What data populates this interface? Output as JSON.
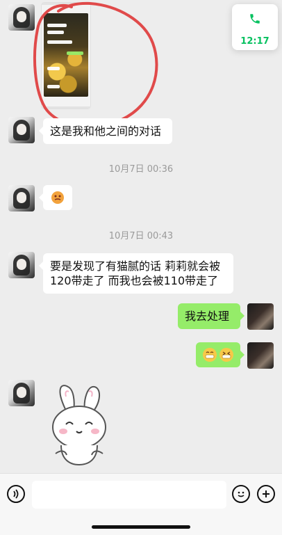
{
  "call_card": {
    "icon": "phone-icon",
    "time": "12:17",
    "accent": "#07c160"
  },
  "messages": {
    "m1_text": "这是我和他之间的对话",
    "t1": "10月7日 00:36",
    "t2": "10月7日 00:43",
    "m3_text": "要是发现了有猫腻的话 莉莉就会被120带走了 而我也会被110带走了",
    "m4_text": "我去处理"
  },
  "colors": {
    "bg": "#ededed",
    "bubble_white": "#ffffff",
    "bubble_green": "#95ec69",
    "annotation_red": "#e04a4a"
  },
  "input_bar": {
    "voice_icon": "voice-icon",
    "emoji_icon": "smiley-icon",
    "plus_icon": "plus-icon"
  }
}
